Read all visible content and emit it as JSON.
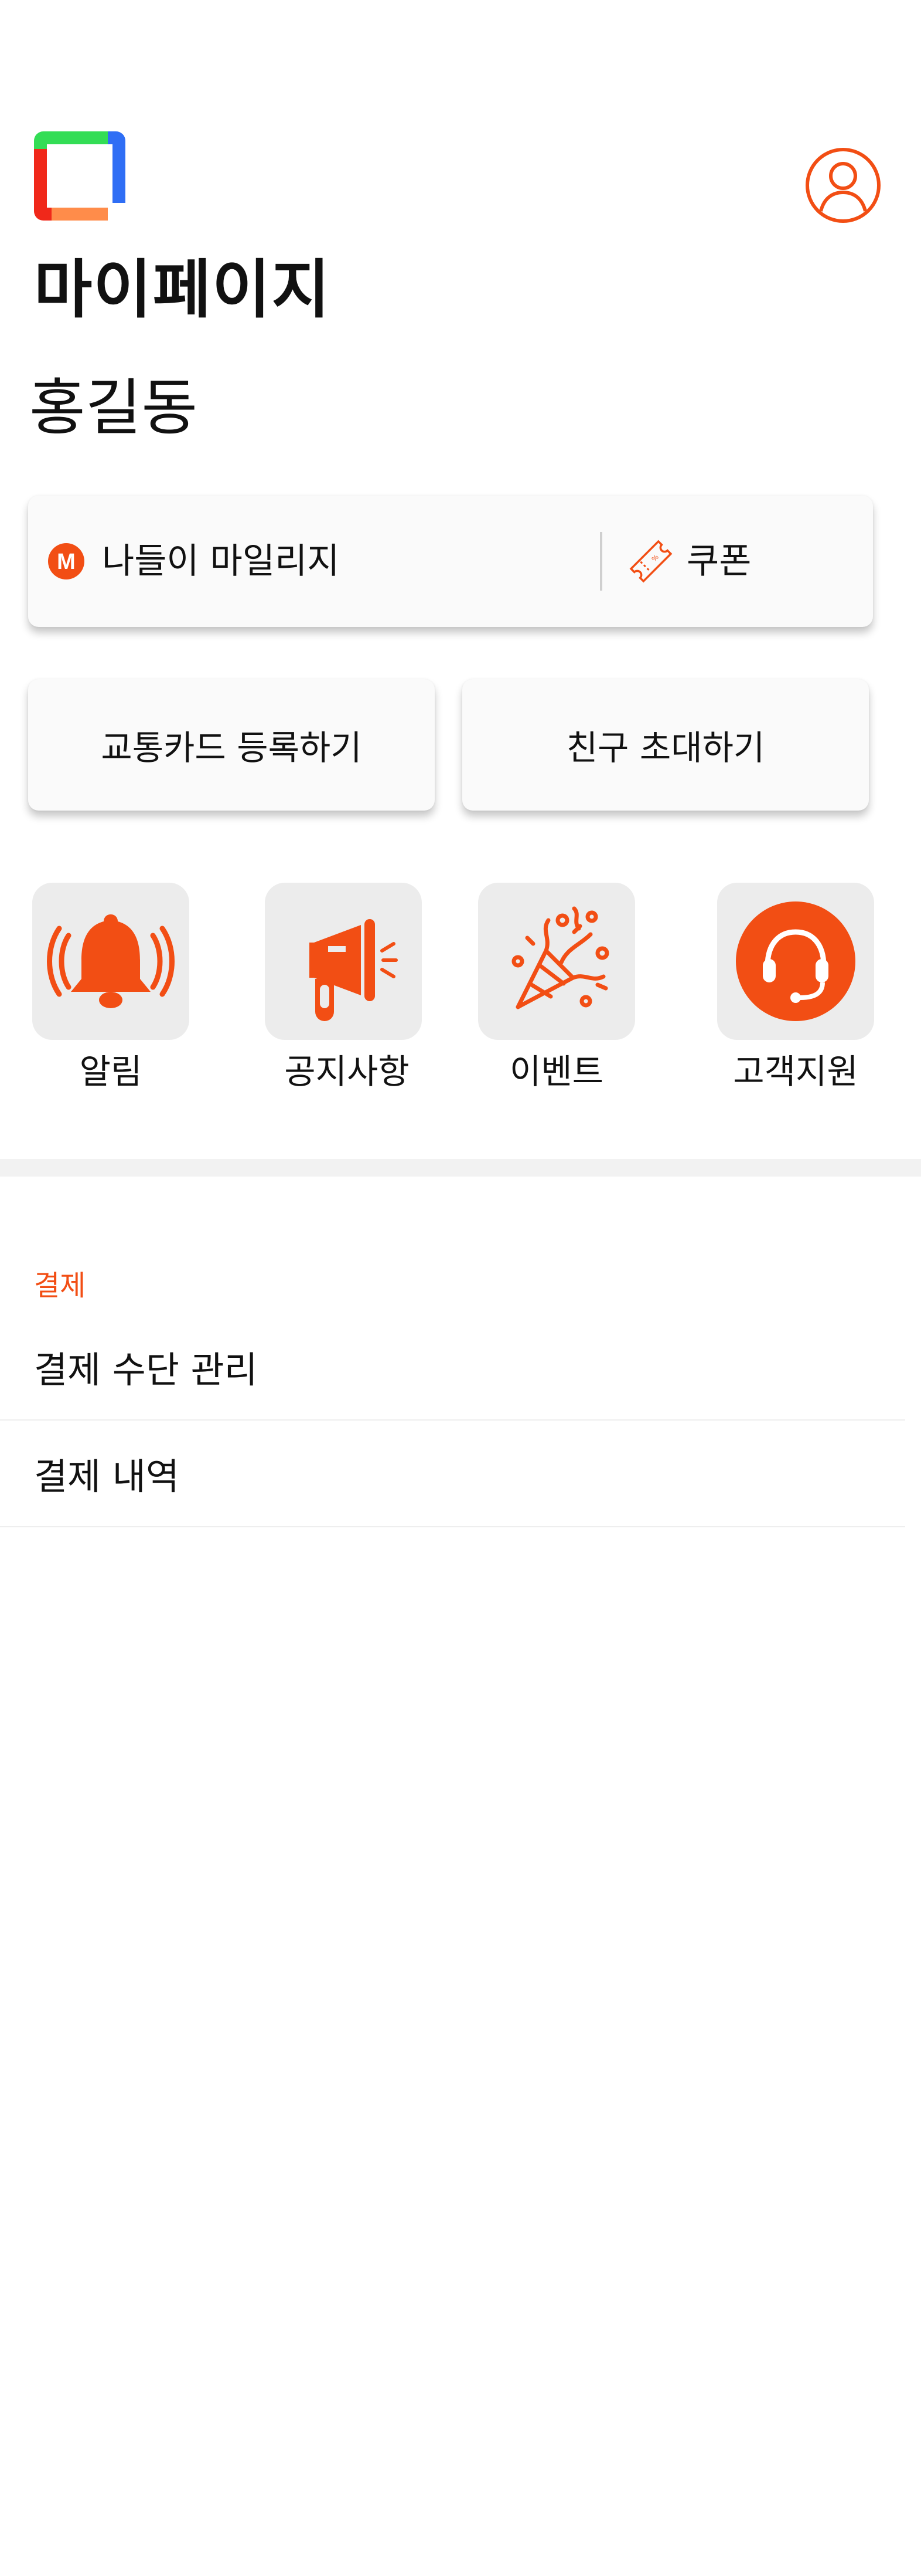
{
  "header": {
    "page_title": "마이페이지",
    "user_name": "홍길동"
  },
  "balance": {
    "mileage_label": "나들이 마일리지",
    "mileage_badge": "M",
    "coupon_label": "쿠폰"
  },
  "actions": {
    "register_card_label": "교통카드 등록하기",
    "invite_friend_label": "친구 초대하기"
  },
  "shortcuts": [
    {
      "label": "알림",
      "icon": "bell-icon"
    },
    {
      "label": "공지사항",
      "icon": "megaphone-icon"
    },
    {
      "label": "이벤트",
      "icon": "party-popper-icon"
    },
    {
      "label": "고객지원",
      "icon": "headset-icon"
    }
  ],
  "payment_section": {
    "header": "결제",
    "items": [
      {
        "label": "결제 수단 관리"
      },
      {
        "label": "결제 내역"
      }
    ]
  },
  "colors": {
    "accent": "#f24e14",
    "tile_bg": "#ececec",
    "logo_green": "#33dd55",
    "logo_blue": "#2f6ef5",
    "logo_red": "#f0281a",
    "logo_orange": "#ff8c4a"
  }
}
